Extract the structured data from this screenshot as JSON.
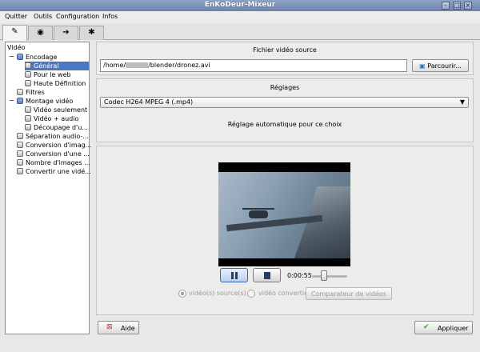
{
  "window": {
    "title": "EnKoDeur-Mixeur",
    "minimize_glyph": "–",
    "maximize_glyph": "□",
    "close_glyph": "×"
  },
  "menu": [
    "Quitter",
    "Outils",
    "Configuration",
    "Infos"
  ],
  "toolbar_tabs": [
    {
      "icon": "tools-icon",
      "glyph": "✎"
    },
    {
      "icon": "eye-icon",
      "glyph": "◉"
    },
    {
      "icon": "arrow-icon",
      "glyph": "➔"
    },
    {
      "icon": "gear-icon",
      "glyph": "✱"
    }
  ],
  "tree": {
    "header": "Vidéo",
    "items": [
      {
        "label": "Encodage",
        "selected": false
      },
      {
        "label": "Général",
        "selected": true
      },
      {
        "label": "Pour le web",
        "selected": false
      },
      {
        "label": "Haute Définition",
        "selected": false
      },
      {
        "label": "Filtres",
        "selected": false
      },
      {
        "label": "Montage vidéo",
        "selected": false
      },
      {
        "label": "Vidéo seulement",
        "selected": false
      },
      {
        "label": "Vidéo + audio",
        "selected": false
      },
      {
        "label": "Découpage d'u...",
        "selected": false
      },
      {
        "label": "Séparation audio-...",
        "selected": false
      },
      {
        "label": "Conversion d'imag...",
        "selected": false
      },
      {
        "label": "Conversion d'une ...",
        "selected": false
      },
      {
        "label": "Nombre d'images ...",
        "selected": false
      },
      {
        "label": "Convertir une vidé...",
        "selected": false
      }
    ],
    "expander_open": "−"
  },
  "source": {
    "heading": "Fichier vidéo source",
    "path_prefix": "/home/",
    "path_suffix": "/blender/dronez.avi",
    "browse_label": "Parcourir..."
  },
  "settings": {
    "heading": "Réglages",
    "codec_selected": "Codec H264 MPEG 4 (.mp4)",
    "info": "Réglage automatique pour ce choix"
  },
  "player": {
    "time": "0:00:55",
    "position_fraction": 0.3,
    "radio_source": "vidéo(s) source(s)",
    "radio_converted": "vidéo convertie",
    "compare_label": "Comparateur de vidéos"
  },
  "footer": {
    "help_label": "Aide",
    "apply_label": "Appliquer"
  },
  "colors": {
    "selection": "#4c78c1",
    "titlebar": "#7a8fb6"
  }
}
